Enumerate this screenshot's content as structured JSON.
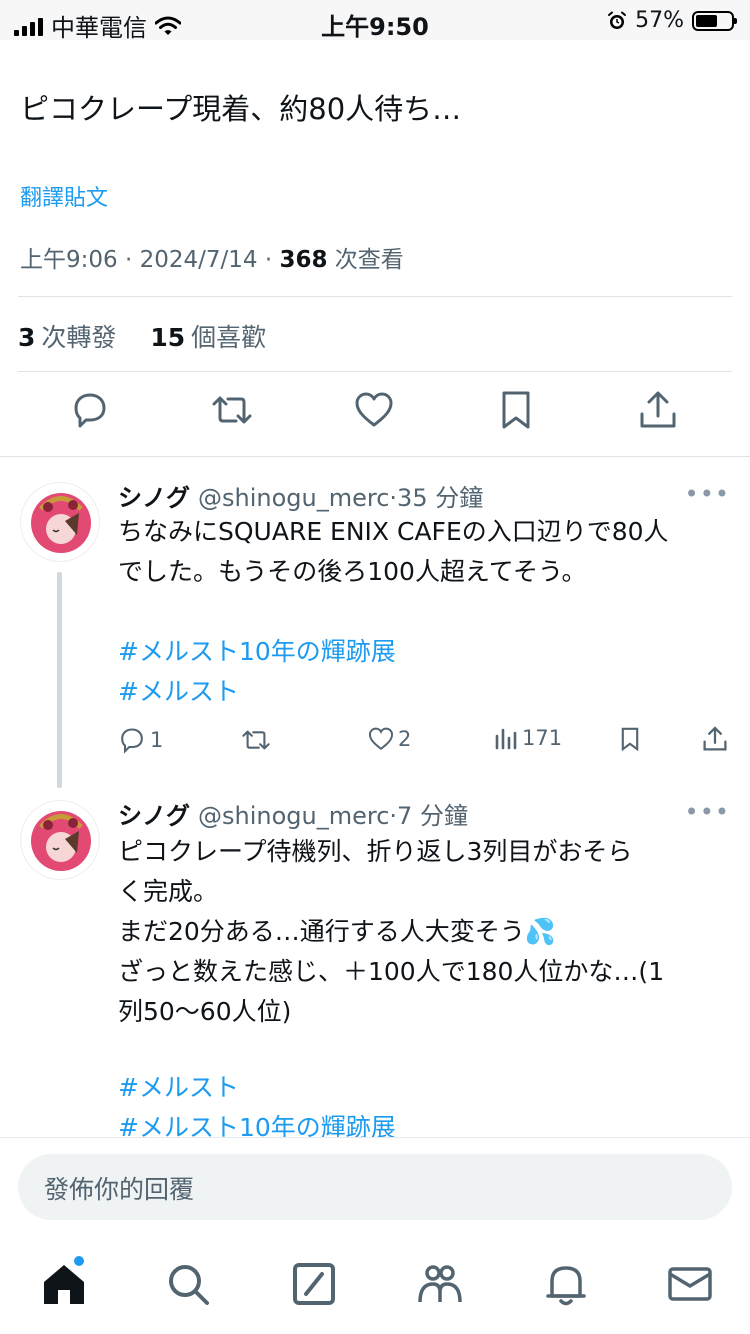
{
  "status_bar": {
    "carrier": "中華電信",
    "time": "上午9:50",
    "battery": "57%"
  },
  "main_tweet": {
    "text": "ピコクレープ現着、約80人待ち…",
    "translate_label": "翻譯貼文",
    "time": "上午9:06",
    "date": "2024/7/14",
    "views_count": "368",
    "views_label": "次查看",
    "reposts_count": "3",
    "reposts_label": "次轉發",
    "likes_count": "15",
    "likes_label": "個喜歡"
  },
  "replies": [
    {
      "name": "シノグ",
      "handle": "@shinogu_merc",
      "time": "35 分鐘",
      "lines": [
        "ちなみにSQUARE ENIX CAFEの入口辺りで80人",
        "でした。もうその後ろ100人超えてそう。"
      ],
      "hashtags": [
        "#メルスト10年の輝跡展",
        "#メルスト"
      ],
      "reply_count": "1",
      "like_count": "2",
      "view_count": "171"
    },
    {
      "name": "シノグ",
      "handle": "@shinogu_merc",
      "time": "7 分鐘",
      "lines": [
        "ピコクレープ待機列、折り返し3列目がおそら",
        "く完成。",
        "まだ20分ある…通行する人大変そう💦",
        "ざっと数えた感じ、＋100人で180人位かな…(1",
        "列50〜60人位)"
      ],
      "hashtags": [
        "#メルスト",
        "#メルスト10年の輝跡展"
      ]
    }
  ],
  "reply_input": {
    "placeholder": "發佈你的回覆"
  },
  "tabs": [
    "home-icon",
    "search-icon",
    "grok-icon",
    "communities-icon",
    "notifications-icon",
    "messages-icon"
  ],
  "colors": {
    "accent": "#1d9bf0",
    "text": "#0f1419",
    "secondary": "#536471"
  }
}
